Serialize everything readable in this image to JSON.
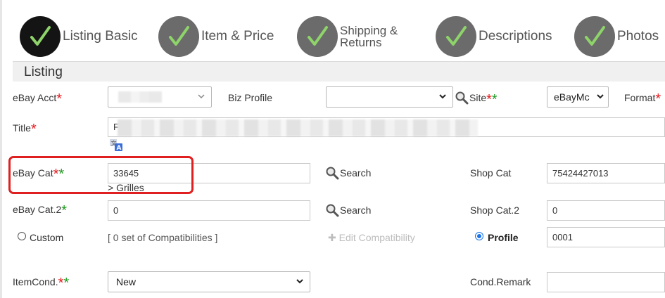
{
  "wizard": {
    "steps": [
      {
        "label": "Listing Basic",
        "state": "active"
      },
      {
        "label": "Item & Price",
        "state": "done"
      },
      {
        "label_line1": "Shipping &",
        "label_line2": "Returns",
        "state": "done"
      },
      {
        "label": "Descriptions",
        "state": "done"
      },
      {
        "label": "Photos",
        "state": "done"
      }
    ]
  },
  "section": {
    "title": "Listing"
  },
  "form": {
    "ebay_acct": {
      "label": "eBay Acct",
      "value": ""
    },
    "biz_profile": {
      "label": "Biz Profile",
      "value": ""
    },
    "site": {
      "label": "Site",
      "value": "eBayMc"
    },
    "format": {
      "label": "Format"
    },
    "title": {
      "label": "Title",
      "value_prefix": "F"
    },
    "ebay_cat": {
      "label": "eBay Cat",
      "value": "33645",
      "path": "> Grilles"
    },
    "search_label": "Search",
    "shop_cat": {
      "label": "Shop Cat",
      "value": "75424427013"
    },
    "ebay_cat2": {
      "label": "eBay Cat.2",
      "value": "0"
    },
    "shop_cat2": {
      "label": "Shop Cat.2",
      "value": "0"
    },
    "compat": {
      "custom_label": "Custom",
      "summary": "[ 0 set of Compatibilities ]",
      "edit_label": "Edit Compatibility",
      "profile_label": "Profile",
      "profile_value": "0001",
      "selected": "profile"
    },
    "item_cond": {
      "label": "ItemCond.",
      "value": "New"
    },
    "cond_remark": {
      "label": "Cond.Remark",
      "value": ""
    }
  },
  "colors": {
    "required_red": "#e8181e",
    "required_green": "#1f9a1f",
    "highlight_box": "#e02020",
    "check_green": "#8ed46a"
  }
}
